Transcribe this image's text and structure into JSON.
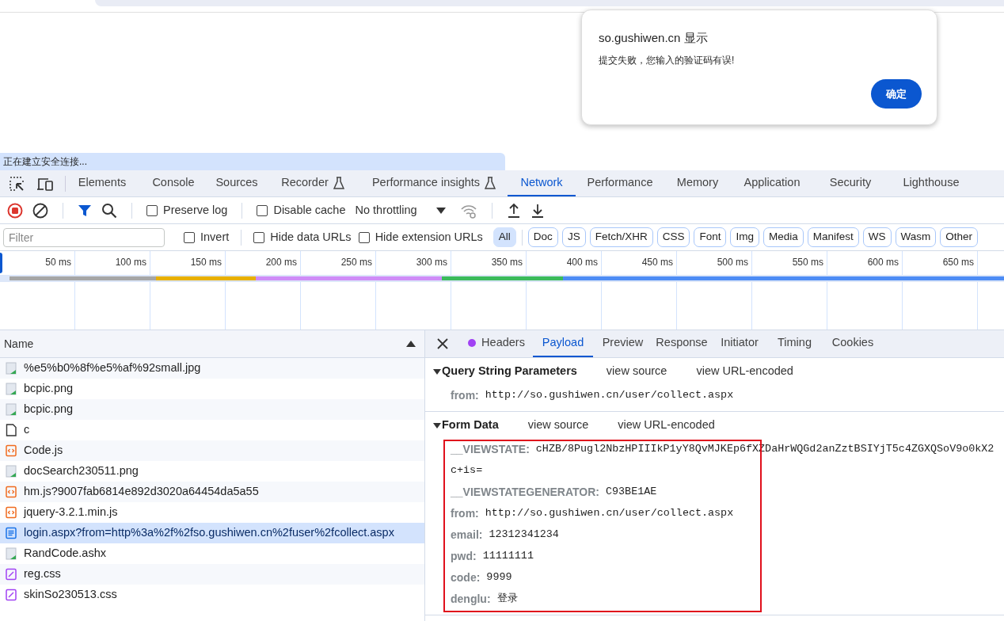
{
  "browser": {
    "status_text": "正在建立安全连接..."
  },
  "dialog": {
    "title": "so.gushiwen.cn 显示",
    "message": "提交失败，您输入的验证码有误!",
    "button": "确定"
  },
  "devtools": {
    "tabs": [
      {
        "label": "Elements",
        "selected": false,
        "experimental": false
      },
      {
        "label": "Console",
        "selected": false,
        "experimental": false
      },
      {
        "label": "Sources",
        "selected": false,
        "experimental": false
      },
      {
        "label": "Recorder",
        "selected": false,
        "experimental": true
      },
      {
        "label": "Performance insights",
        "selected": false,
        "experimental": true
      },
      {
        "label": "Network",
        "selected": true,
        "experimental": false
      },
      {
        "label": "Performance",
        "selected": false,
        "experimental": false
      },
      {
        "label": "Memory",
        "selected": false,
        "experimental": false
      },
      {
        "label": "Application",
        "selected": false,
        "experimental": false
      },
      {
        "label": "Security",
        "selected": false,
        "experimental": false
      },
      {
        "label": "Lighthouse",
        "selected": false,
        "experimental": false
      }
    ],
    "toolbar": {
      "checkboxes": [
        {
          "label": "Preserve log",
          "checked": false
        },
        {
          "label": "Disable cache",
          "checked": false
        }
      ],
      "throttling": "No throttling"
    },
    "filter": {
      "placeholder": "Filter",
      "checkboxes": [
        {
          "label": "Invert",
          "checked": false
        },
        {
          "label": "Hide data URLs",
          "checked": false
        },
        {
          "label": "Hide extension URLs",
          "checked": false
        }
      ],
      "types": [
        {
          "label": "All",
          "selected": true
        },
        {
          "label": "Doc",
          "selected": false
        },
        {
          "label": "JS",
          "selected": false
        },
        {
          "label": "Fetch/XHR",
          "selected": false
        },
        {
          "label": "CSS",
          "selected": false
        },
        {
          "label": "Font",
          "selected": false
        },
        {
          "label": "Img",
          "selected": false
        },
        {
          "label": "Media",
          "selected": false
        },
        {
          "label": "Manifest",
          "selected": false
        },
        {
          "label": "WS",
          "selected": false
        },
        {
          "label": "Wasm",
          "selected": false
        },
        {
          "label": "Other",
          "selected": false
        }
      ]
    },
    "timeline": {
      "ticks": [
        "50 ms",
        "100 ms",
        "150 ms",
        "200 ms",
        "250 ms",
        "300 ms",
        "350 ms",
        "400 ms",
        "450 ms",
        "500 ms",
        "550 ms",
        "600 ms",
        "650 ms"
      ]
    },
    "requests": {
      "column": "Name",
      "rows": [
        {
          "name": "%e5%b0%8f%e5%af%92small.jpg",
          "kind": "image",
          "selected": false
        },
        {
          "name": "bcpic.png",
          "kind": "image",
          "selected": false
        },
        {
          "name": "bcpic.png",
          "kind": "image",
          "selected": false
        },
        {
          "name": "c",
          "kind": "other",
          "selected": false
        },
        {
          "name": "Code.js",
          "kind": "script",
          "selected": false
        },
        {
          "name": "docSearch230511.png",
          "kind": "image",
          "selected": false
        },
        {
          "name": "hm.js?9007fab6814e892d3020a64454da5a55",
          "kind": "script",
          "selected": false
        },
        {
          "name": "jquery-3.2.1.min.js",
          "kind": "script",
          "selected": false
        },
        {
          "name": "login.aspx?from=http%3a%2f%2fso.gushiwen.cn%2fuser%2fcollect.aspx",
          "kind": "document",
          "selected": true
        },
        {
          "name": "RandCode.ashx",
          "kind": "image",
          "selected": false
        },
        {
          "name": "reg.css",
          "kind": "stylesheet",
          "selected": false
        },
        {
          "name": "skinSo230513.css",
          "kind": "stylesheet",
          "selected": false
        }
      ]
    },
    "detail": {
      "tabs": [
        {
          "label": "Headers",
          "selected": false,
          "dot": true
        },
        {
          "label": "Payload",
          "selected": true,
          "dot": false
        },
        {
          "label": "Preview",
          "selected": false,
          "dot": false
        },
        {
          "label": "Response",
          "selected": false,
          "dot": false
        },
        {
          "label": "Initiator",
          "selected": false,
          "dot": false
        },
        {
          "label": "Timing",
          "selected": false,
          "dot": false
        },
        {
          "label": "Cookies",
          "selected": false,
          "dot": false
        }
      ],
      "sections": [
        {
          "title": "Query String Parameters",
          "expanded": true,
          "highlighted": false,
          "links": [
            "view source",
            "view URL-encoded"
          ],
          "params": [
            {
              "key": "from:",
              "value_lines": [
                "http://so.gushiwen.cn/user/collect.aspx"
              ]
            }
          ]
        },
        {
          "title": "Form Data",
          "expanded": true,
          "highlighted": true,
          "links": [
            "view source",
            "view URL-encoded"
          ],
          "params": [
            {
              "key": "__VIEWSTATE:",
              "value_lines": [
                "cHZB/8Pugl2NbzHPIIIkP1yY8QvMJKEp6fXZDaHrWQGd2anZztBSIYjT5c4ZGXQSoV9o0kX2",
                "c+is="
              ]
            },
            {
              "key": "__VIEWSTATEGENERATOR:",
              "value_lines": [
                "C93BE1AE"
              ]
            },
            {
              "key": "from:",
              "value_lines": [
                "http://so.gushiwen.cn/user/collect.aspx"
              ]
            },
            {
              "key": "email:",
              "value_lines": [
                "12312341234"
              ]
            },
            {
              "key": "pwd:",
              "value_lines": [
                "11111111"
              ]
            },
            {
              "key": "code:",
              "value_lines": [
                "9999"
              ]
            },
            {
              "key": "denglu:",
              "value_lines": [
                "登录"
              ]
            }
          ]
        }
      ]
    }
  }
}
